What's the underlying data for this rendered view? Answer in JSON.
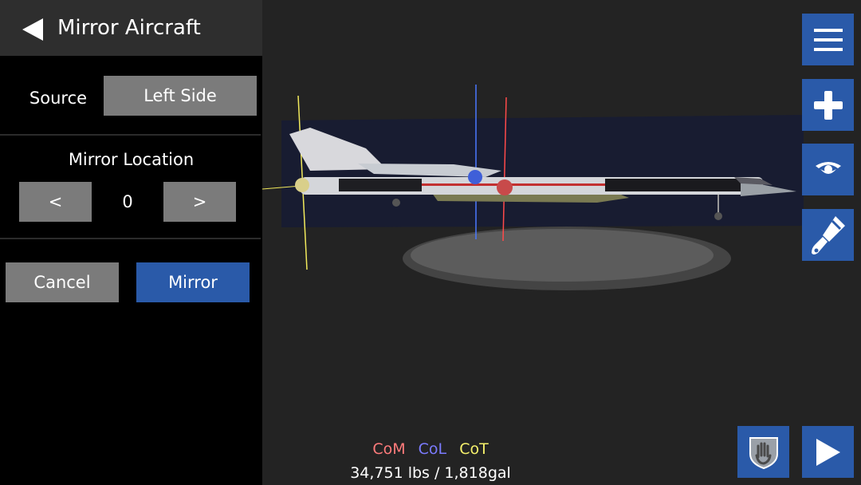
{
  "panel": {
    "title": "Mirror Aircraft",
    "source_label": "Source",
    "source_value": "Left Side",
    "mirror_location_label": "Mirror Location",
    "location_prev": "<",
    "location_value": "0",
    "location_next": ">",
    "cancel_label": "Cancel",
    "mirror_label": "Mirror"
  },
  "toolbar": {
    "items": [
      {
        "name": "menu",
        "icon": "hamburger-menu-icon"
      },
      {
        "name": "add-part",
        "icon": "plus-icon"
      },
      {
        "name": "view",
        "icon": "eye-icon"
      },
      {
        "name": "paint",
        "icon": "paint-brush-icon"
      }
    ],
    "grab_icon": "hand-shield-icon",
    "play_icon": "play-icon"
  },
  "legend": {
    "com": "CoM",
    "col": "CoL",
    "cot": "CoT",
    "colors": {
      "com": "#ff7b7b",
      "col": "#7b7bff",
      "cot": "#f5f06b"
    }
  },
  "stats": {
    "text": "34,751 lbs / 1,818gal"
  },
  "colors": {
    "accent": "#2a5aa9",
    "button_gray": "#7b7b7b",
    "panel_bg": "#000000",
    "header_bg": "#2e2e2e",
    "viewport_bg": "#232323"
  }
}
